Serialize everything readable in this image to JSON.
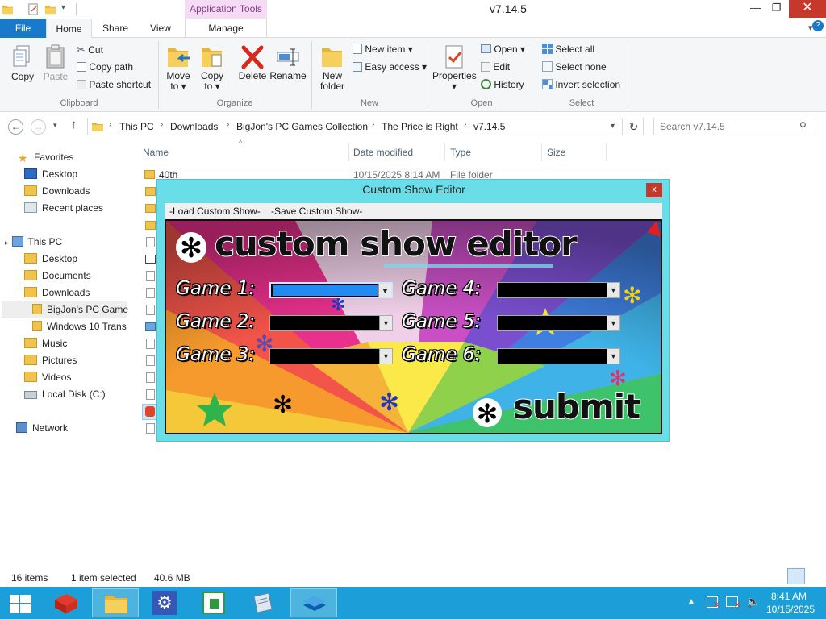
{
  "window": {
    "title": "v7.14.5",
    "context_tab_group": "Application Tools"
  },
  "ribbon_tabs": {
    "file": "File",
    "home": "Home",
    "share": "Share",
    "view": "View",
    "manage": "Manage"
  },
  "ribbon": {
    "clipboard": {
      "label": "Clipboard",
      "copy": "Copy",
      "paste": "Paste",
      "cut": "Cut",
      "copy_path": "Copy path",
      "paste_shortcut": "Paste shortcut"
    },
    "organize": {
      "label": "Organize",
      "move_to": "Move to",
      "copy_to": "Copy to",
      "delete": "Delete",
      "rename": "Rename"
    },
    "new": {
      "label": "New",
      "new_folder": "New folder",
      "new_item": "New item",
      "easy_access": "Easy access"
    },
    "open": {
      "label": "Open",
      "properties": "Properties",
      "open": "Open",
      "edit": "Edit",
      "history": "History"
    },
    "select": {
      "label": "Select",
      "select_all": "Select all",
      "select_none": "Select none",
      "invert_selection": "Invert selection"
    }
  },
  "address": {
    "crumbs": [
      "This PC",
      "Downloads",
      "BigJon's PC Games Collection",
      "The Price is Right",
      "v7.14.5"
    ],
    "search_placeholder": "Search v7.14.5"
  },
  "nav": {
    "favorites": "Favorites",
    "favorites_items": [
      "Desktop",
      "Downloads",
      "Recent places"
    ],
    "this_pc": "This PC",
    "this_pc_items": [
      "Desktop",
      "Documents",
      "Downloads"
    ],
    "downloads_children": [
      "BigJon's PC Game",
      "Windows 10 Trans"
    ],
    "more_items": [
      "Music",
      "Pictures",
      "Videos",
      "Local Disk (C:)"
    ],
    "network": "Network"
  },
  "file_list": {
    "columns": [
      "Name",
      "Date modified",
      "Type",
      "Size"
    ],
    "first_row": {
      "name": "40th",
      "date": "10/15/2025 8:14 AM",
      "type": "File folder"
    }
  },
  "status": {
    "item_count": "16 items",
    "selection": "1 item selected",
    "size": "40.6 MB"
  },
  "dialog": {
    "title": "Custom Show Editor",
    "close": "x",
    "menu": [
      "-Load Custom Show-",
      "-Save Custom Show-"
    ],
    "heading": "custom show editor",
    "games": [
      "Game 1:",
      "Game 2:",
      "Game 3:",
      "Game 4:",
      "Game 5:",
      "Game 6:"
    ],
    "submit": "submit"
  },
  "taskbar": {
    "time": "8:41 AM",
    "date": "10/15/2025"
  },
  "colors": {
    "accent": "#1979ca",
    "taskbar": "#1c9fd8",
    "dialog_frame": "#69dde8",
    "close_red": "#c7382c"
  }
}
